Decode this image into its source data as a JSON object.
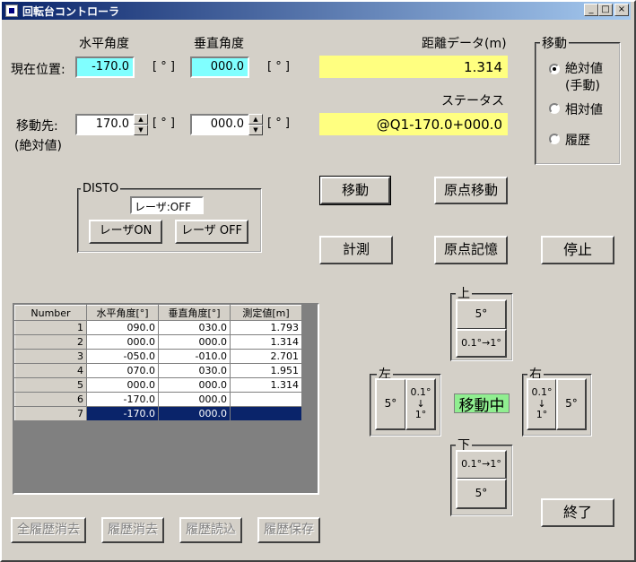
{
  "window": {
    "title": "回転台コントローラ"
  },
  "labels": {
    "horizontal_angle": "水平角度",
    "vertical_angle": "垂直角度",
    "distance_data": "距離データ(m)",
    "current_position": "現在位置:",
    "degree_unit": "[ ° ]",
    "status": "ステータス",
    "move_to": "移動先:",
    "absolute_paren": "(絶対値)"
  },
  "current": {
    "horizontal": "-170.0",
    "vertical": "000.0",
    "distance": "1.314"
  },
  "target": {
    "horizontal": "170.0",
    "vertical": "000.0"
  },
  "status_value": "@Q1-170.0+000.0",
  "move_group": {
    "title": "移動",
    "options": [
      {
        "line1": "絶対値",
        "line2": "(手動)",
        "selected": true
      },
      {
        "line1": "相対値",
        "line2": "",
        "selected": false
      },
      {
        "line1": "履歴",
        "line2": "",
        "selected": false
      }
    ]
  },
  "disto": {
    "title": "DISTO",
    "status": "レーザ:OFF",
    "laser_on": "レーザON",
    "laser_off": "レーザ OFF"
  },
  "buttons": {
    "move": "移動",
    "origin_move": "原点移動",
    "measure": "計測",
    "origin_store": "原点記憶",
    "stop": "停止",
    "exit": "終了",
    "clear_all_history": "全履歴消去",
    "clear_history": "履歴消去",
    "load_history": "履歴読込",
    "save_history": "履歴保存"
  },
  "jog": {
    "up_title": "上",
    "down_title": "下",
    "left_title": "左",
    "right_title": "右",
    "five_deg": "5°",
    "fine_vertical": "0.1°→1°",
    "fine_h_1": "0.1°",
    "fine_h_2": "↓",
    "fine_h_3": "1°",
    "moving": "移動中"
  },
  "table": {
    "headers": [
      "Number",
      "水平角度[°]",
      "垂直角度[°]",
      "測定値[m]"
    ],
    "rows": [
      [
        "1",
        "090.0",
        "030.0",
        "1.793"
      ],
      [
        "2",
        "000.0",
        "000.0",
        "1.314"
      ],
      [
        "3",
        "-050.0",
        "-010.0",
        "2.701"
      ],
      [
        "4",
        "070.0",
        "030.0",
        "1.951"
      ],
      [
        "5",
        "000.0",
        "000.0",
        "1.314"
      ],
      [
        "6",
        "-170.0",
        "000.0",
        ""
      ],
      [
        "7",
        "-170.0",
        "000.0",
        ""
      ]
    ],
    "selected_row": 7
  },
  "colors": {
    "cyan_field": "#80ffff",
    "yellow_field": "#ffff80",
    "moving_bg": "#90ee90",
    "selection": "#0a246a"
  }
}
